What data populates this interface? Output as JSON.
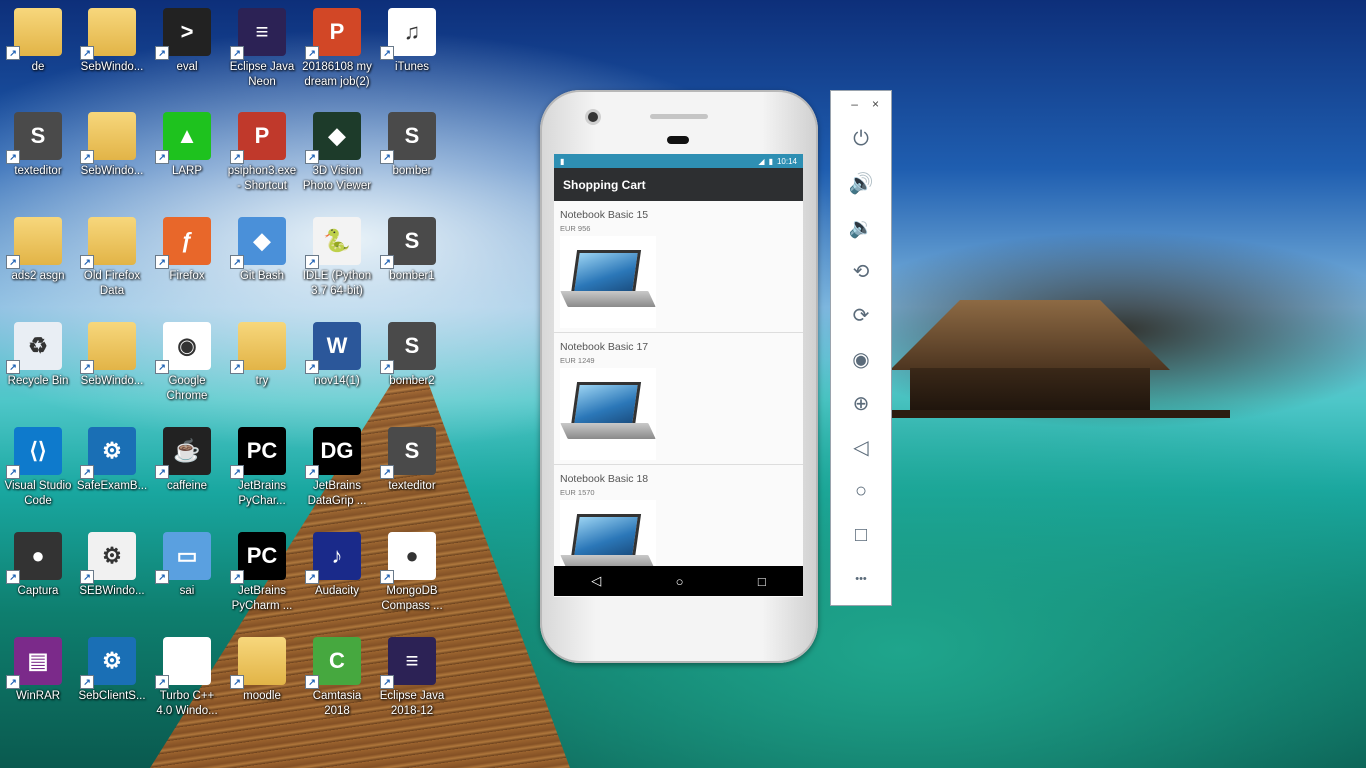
{
  "desktop": {
    "icons": [
      {
        "label": "de",
        "icon": "folder-icon",
        "kind": "folder"
      },
      {
        "label": "SebWindo...",
        "icon": "folder-icon",
        "kind": "folder"
      },
      {
        "label": "eval",
        "icon": "python-file-icon",
        "kind": "python"
      },
      {
        "label": "Eclipse Java\nNeon",
        "icon": "eclipse-icon",
        "kind": "eclipse"
      },
      {
        "label": "20186108 my\ndream job(2)",
        "icon": "powerpoint-icon",
        "kind": "ppt"
      },
      {
        "label": "iTunes",
        "icon": "itunes-icon",
        "kind": "itunes"
      },
      {
        "label": "texteditor",
        "icon": "sublime-text-icon",
        "kind": "sublime"
      },
      {
        "label": "SebWindo...",
        "icon": "folder-icon",
        "kind": "folder"
      },
      {
        "label": "LARP",
        "icon": "larp-icon",
        "kind": "larp"
      },
      {
        "label": "psiphon3.exe\n- Shortcut",
        "icon": "psiphon-icon",
        "kind": "psiphon"
      },
      {
        "label": "3D Vision\nPhoto Viewer",
        "icon": "3d-vision-icon",
        "kind": "vision"
      },
      {
        "label": "bomber",
        "icon": "sublime-text-icon",
        "kind": "sublime"
      },
      {
        "label": "ads2 asgn",
        "icon": "folder-icon",
        "kind": "folder"
      },
      {
        "label": "Old Firefox\nData",
        "icon": "folder-icon",
        "kind": "folder"
      },
      {
        "label": "Firefox",
        "icon": "firefox-icon",
        "kind": "firefox"
      },
      {
        "label": "Git Bash",
        "icon": "git-bash-icon",
        "kind": "git"
      },
      {
        "label": "IDLE (Python\n3.7 64-bit)",
        "icon": "idle-python-icon",
        "kind": "idle"
      },
      {
        "label": "bomber1",
        "icon": "sublime-text-icon",
        "kind": "sublime"
      },
      {
        "label": "Recycle Bin",
        "icon": "recycle-bin-icon",
        "kind": "recycle"
      },
      {
        "label": "SebWindo...",
        "icon": "folder-icon",
        "kind": "folder"
      },
      {
        "label": "Google\nChrome",
        "icon": "chrome-icon",
        "kind": "chrome"
      },
      {
        "label": "try",
        "icon": "folder-icon",
        "kind": "folder"
      },
      {
        "label": "nov14(1)",
        "icon": "word-icon",
        "kind": "word"
      },
      {
        "label": "bomber2",
        "icon": "sublime-text-icon",
        "kind": "sublime"
      },
      {
        "label": "Visual Studio\nCode",
        "icon": "vscode-icon",
        "kind": "vscode"
      },
      {
        "label": "SafeExamB...",
        "icon": "safe-exam-browser-icon",
        "kind": "seb"
      },
      {
        "label": "caffeine",
        "icon": "caffeine-icon",
        "kind": "caffeine"
      },
      {
        "label": "JetBrains\nPyChar...",
        "icon": "pycharm-icon",
        "kind": "pycharm"
      },
      {
        "label": "JetBrains\nDataGrip ...",
        "icon": "datagrip-icon",
        "kind": "datagrip"
      },
      {
        "label": "texteditor",
        "icon": "sublime-text-icon",
        "kind": "sublime"
      },
      {
        "label": "Captura",
        "icon": "captura-icon",
        "kind": "captura"
      },
      {
        "label": "SEBWindo...",
        "icon": "settings-file-icon",
        "kind": "settings"
      },
      {
        "label": "sai",
        "icon": "computer-icon",
        "kind": "computer"
      },
      {
        "label": "JetBrains\nPyCharm ...",
        "icon": "pycharm-icon",
        "kind": "pycharm"
      },
      {
        "label": "Audacity",
        "icon": "audacity-icon",
        "kind": "audacity"
      },
      {
        "label": "MongoDB\nCompass ...",
        "icon": "mongodb-icon",
        "kind": "mongo"
      },
      {
        "label": "WinRAR",
        "icon": "winrar-icon",
        "kind": "winrar"
      },
      {
        "label": "SebClientS...",
        "icon": "safe-exam-browser-icon",
        "kind": "seb"
      },
      {
        "label": "Turbo C++\n4.0 Windo...",
        "icon": "turbo-cpp-icon",
        "kind": "turbo"
      },
      {
        "label": "moodle",
        "icon": "folder-icon",
        "kind": "folder"
      },
      {
        "label": "Camtasia\n2018",
        "icon": "camtasia-icon",
        "kind": "camtasia"
      },
      {
        "label": "Eclipse Java\n2018-12",
        "icon": "eclipse-icon",
        "kind": "eclipse"
      }
    ]
  },
  "emulator": {
    "status_time": "10:14",
    "app_title": "Shopping Cart",
    "products": [
      {
        "name": "Notebook Basic 15",
        "price": "EUR 956"
      },
      {
        "name": "Notebook Basic 17",
        "price": "EUR 1249"
      },
      {
        "name": "Notebook Basic 18",
        "price": "EUR 1570"
      }
    ],
    "nav": {
      "back": "◁",
      "home": "○",
      "recents": "□"
    },
    "toolbar": {
      "minimize": "–",
      "close": "×",
      "buttons": [
        {
          "icon": "power-icon",
          "glyph": "⏻"
        },
        {
          "icon": "volume-up-icon",
          "glyph": "🔊"
        },
        {
          "icon": "volume-down-icon",
          "glyph": "🔉"
        },
        {
          "icon": "rotate-left-icon",
          "glyph": "⟲"
        },
        {
          "icon": "rotate-right-icon",
          "glyph": "⟳"
        },
        {
          "icon": "camera-icon",
          "glyph": "◉"
        },
        {
          "icon": "zoom-icon",
          "glyph": "⊕"
        },
        {
          "icon": "back-icon",
          "glyph": "◁"
        },
        {
          "icon": "home-icon",
          "glyph": "○"
        },
        {
          "icon": "overview-icon",
          "glyph": "□"
        },
        {
          "icon": "more-icon",
          "glyph": "•••"
        }
      ]
    }
  }
}
